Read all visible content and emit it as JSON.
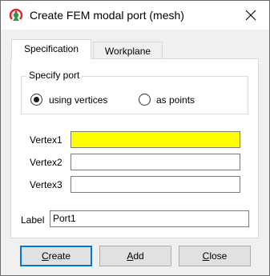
{
  "window": {
    "title": "Create FEM modal port (mesh)"
  },
  "tabs": [
    {
      "label": "Specification",
      "active": true
    },
    {
      "label": "Workplane",
      "active": false
    }
  ],
  "specify_port": {
    "title": "Specify port",
    "options": [
      {
        "label": "using vertices",
        "selected": true
      },
      {
        "label": "as points",
        "selected": false
      }
    ]
  },
  "vertices": [
    {
      "label": "Vertex1",
      "value": "",
      "highlight_color": "#ffff00"
    },
    {
      "label": "Vertex2",
      "value": ""
    },
    {
      "label": "Vertex3",
      "value": ""
    }
  ],
  "label_field": {
    "label": "Label",
    "value": "Port1"
  },
  "buttons": {
    "create": {
      "underline": "C",
      "rest": "reate"
    },
    "add": {
      "underline": "A",
      "rest": "dd"
    },
    "close": {
      "underline": "C",
      "rest": "lose"
    }
  },
  "colors": {
    "accent": "#0078d7",
    "active_field": "#ffff00"
  }
}
